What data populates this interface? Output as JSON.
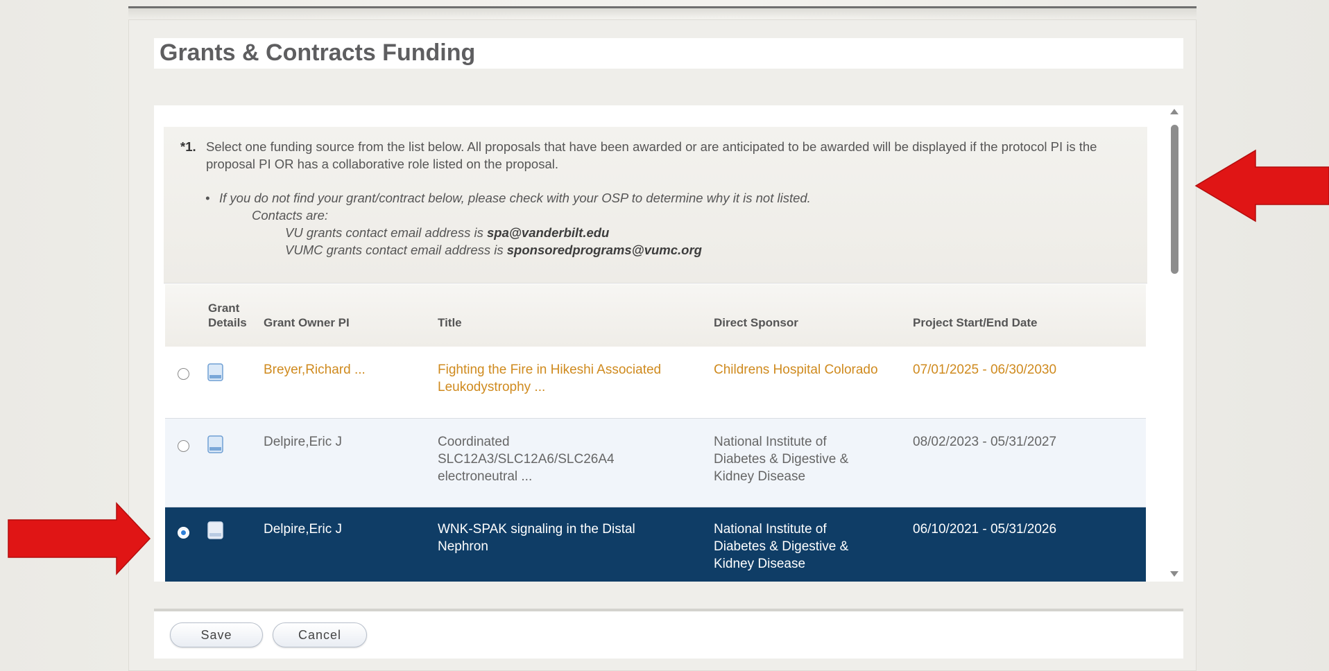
{
  "page": {
    "title": "Grants & Contracts Funding"
  },
  "question": {
    "number": "*1.",
    "text": "Select one funding source from the list below. All proposals that have been awarded or are anticipated to be awarded will be displayed if the protocol PI is the proposal PI OR has a collaborative role listed on the proposal.",
    "note_line1": "If you do not find your grant/contract below, please check with your OSP to determine why it is not listed.",
    "note_line2": "Contacts are:",
    "vu_prefix": "VU grants contact email address is ",
    "vu_email": "spa@vanderbilt.edu",
    "vumc_prefix": "VUMC grants contact email address is ",
    "vumc_email": "sponsoredprograms@vumc.org"
  },
  "table": {
    "headers": {
      "grant_details_1": "Grant",
      "grant_details_2": "Details",
      "owner": "Grant Owner PI",
      "title": "Title",
      "sponsor": "Direct Sponsor",
      "dates": "Project Start/End Date"
    },
    "rows": [
      {
        "selected": false,
        "owner": "Breyer,Richard ...",
        "title_l1": "Fighting the Fire in Hikeshi Associated",
        "title_l2": "Leukodystrophy ...",
        "title_l3": "",
        "sponsor_l1": "Childrens Hospital Colorado",
        "sponsor_l2": "",
        "sponsor_l3": "",
        "dates": "07/01/2025 - 06/30/2030"
      },
      {
        "selected": false,
        "owner": "Delpire,Eric J",
        "title_l1": "Coordinated",
        "title_l2": "SLC12A3/SLC12A6/SLC26A4",
        "title_l3": "electroneutral ...",
        "sponsor_l1": "National Institute of",
        "sponsor_l2": "Diabetes & Digestive &",
        "sponsor_l3": "Kidney Disease",
        "dates": "08/02/2023 - 05/31/2027"
      },
      {
        "selected": true,
        "owner": "Delpire,Eric J",
        "title_l1": "WNK-SPAK signaling in the Distal",
        "title_l2": "Nephron",
        "title_l3": "",
        "sponsor_l1": "National Institute of",
        "sponsor_l2": "Diabetes & Digestive &",
        "sponsor_l3": "Kidney Disease",
        "dates": "06/10/2021 - 05/31/2026"
      }
    ]
  },
  "buttons": {
    "save": "Save",
    "cancel": "Cancel"
  },
  "colors": {
    "accent_link": "#cf8a1e",
    "selected_row": "#0f3d66",
    "arrow": "#e01515"
  }
}
